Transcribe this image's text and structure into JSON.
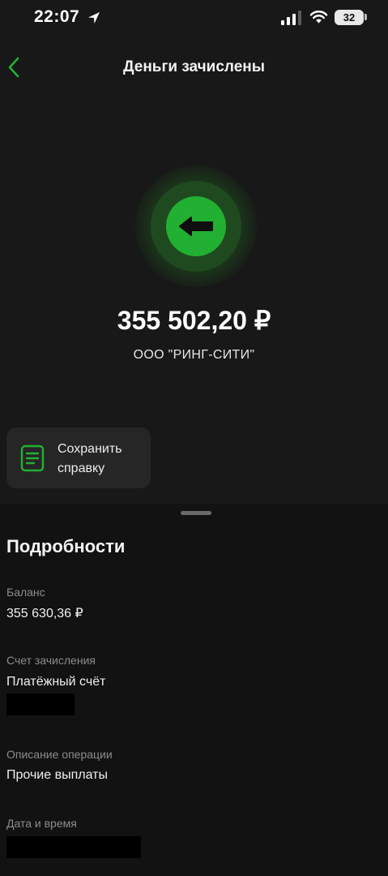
{
  "status_bar": {
    "time": "22:07",
    "battery": "32"
  },
  "header": {
    "title": "Деньги зачислены"
  },
  "transaction": {
    "amount": "355 502,20 ₽",
    "payer": "ООО \"РИНГ-СИТИ\""
  },
  "actions": {
    "save_receipt": "Сохранить справку"
  },
  "details": {
    "title": "Подробности",
    "balance_label": "Баланс",
    "balance_value": "355 630,36 ₽",
    "account_label": "Счет зачисления",
    "account_value": "Платёжный счёт",
    "description_label": "Описание операции",
    "description_value": "Прочие выплаты",
    "datetime_label": "Дата и время"
  },
  "colors": {
    "accent": "#22b032",
    "background": "#121212",
    "top_area": "#181818",
    "card": "#262626"
  },
  "icons": {
    "back": "chevron-left-icon",
    "transaction": "arrow-left-icon",
    "document": "document-icon",
    "location": "location-arrow-icon",
    "signal": "cellular-signal-icon",
    "wifi": "wifi-icon",
    "battery": "battery-icon"
  }
}
